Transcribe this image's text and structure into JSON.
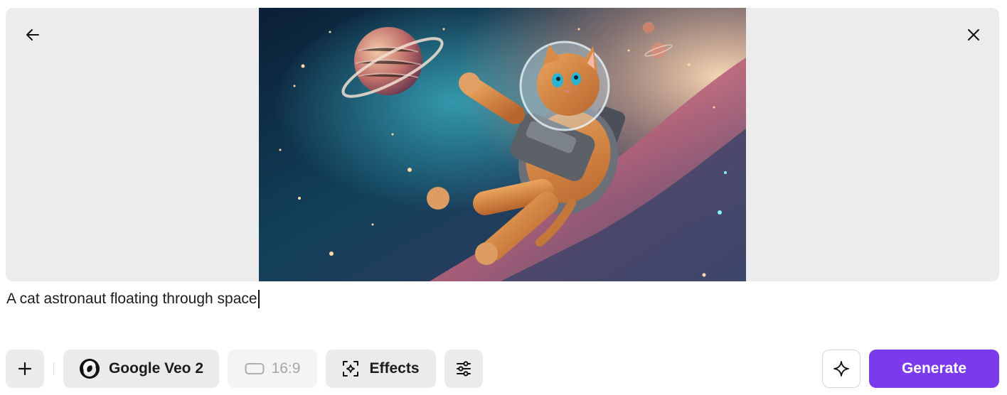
{
  "preview": {
    "image_alt": "A cat astronaut floating through space"
  },
  "prompt": {
    "value": "A cat astronaut floating through space"
  },
  "toolbar": {
    "model_label": "Google Veo 2",
    "ratio_label": "16:9",
    "effects_label": "Effects",
    "generate_label": "Generate"
  },
  "colors": {
    "accent": "#7c3aed",
    "button_bg": "#ebebeb",
    "preview_bg": "#ececec"
  }
}
